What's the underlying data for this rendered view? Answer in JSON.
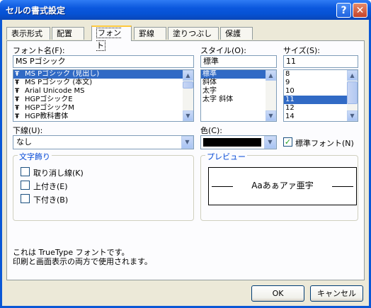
{
  "window": {
    "title": "セルの書式設定"
  },
  "tabs": [
    {
      "label": "表示形式"
    },
    {
      "label": "配置"
    },
    {
      "label": "フォント"
    },
    {
      "label": "罫線"
    },
    {
      "label": "塗りつぶし"
    },
    {
      "label": "保護"
    }
  ],
  "font_name": {
    "label": "フォント名(F):",
    "value": "MS Pゴシック",
    "items": [
      "MS Pゴシック (見出し)",
      "MS Pゴシック (本文)",
      "Arial Unicode MS",
      "HGPゴシックE",
      "HGPゴシックM",
      "HGP教科書体"
    ],
    "selected": 0
  },
  "style": {
    "label": "スタイル(O):",
    "value": "標準",
    "items": [
      "標準",
      "斜体",
      "太字",
      "太字 斜体"
    ],
    "selected": 0
  },
  "size": {
    "label": "サイズ(S):",
    "value": "11",
    "items": [
      "8",
      "9",
      "10",
      "11",
      "12",
      "14"
    ],
    "selected": 3
  },
  "underline": {
    "label": "下線(U):",
    "value": "なし"
  },
  "color": {
    "label": "色(C):",
    "swatch": "#000000"
  },
  "normal_font": {
    "label": "標準フォント(N)",
    "checked": true
  },
  "effects": {
    "title": "文字飾り",
    "items": [
      {
        "label": "取り消し線(K)",
        "checked": false
      },
      {
        "label": "上付き(E)",
        "checked": false
      },
      {
        "label": "下付き(B)",
        "checked": false
      }
    ]
  },
  "preview": {
    "title": "プレビュー",
    "sample": "Aaあぁアァ亜宇"
  },
  "info": {
    "line1": "これは TrueType フォントです。",
    "line2": "印刷と画面表示の両方で使用されます。"
  },
  "buttons": {
    "ok": "OK",
    "cancel": "キャンセル"
  },
  "icons": {
    "truetype": "truetype-font-icon"
  }
}
